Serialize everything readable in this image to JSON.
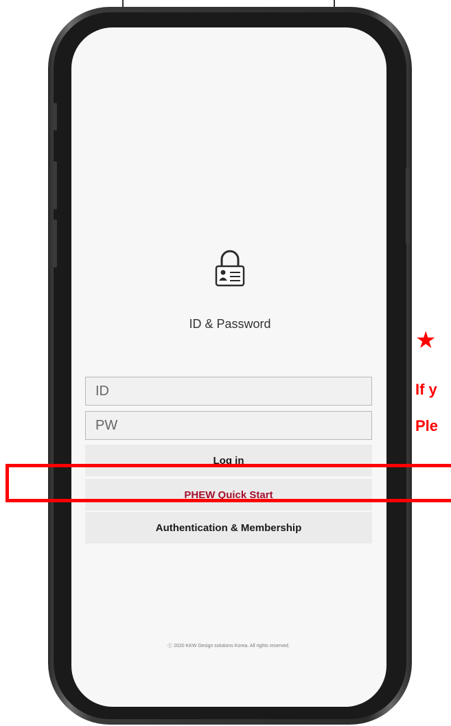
{
  "login": {
    "title": "ID & Password",
    "id_placeholder": "ID",
    "pw_placeholder": "PW",
    "login_button": "Log in",
    "quick_start_button": "PHEW Quick Start",
    "auth_button": "Authentication & Membership",
    "footer": "ⓒ 2020 KKW Design solutions Korea. All rights reserved."
  },
  "annotation": {
    "star": "★",
    "line1": "If y",
    "line2": "Ple",
    "color": "#ff0000"
  },
  "colors": {
    "quick_start_text": "#a3102d",
    "button_bg": "#ebebeb",
    "screen_bg": "#f7f7f7"
  },
  "icons": {
    "lock": "padlock-id-card-icon"
  }
}
